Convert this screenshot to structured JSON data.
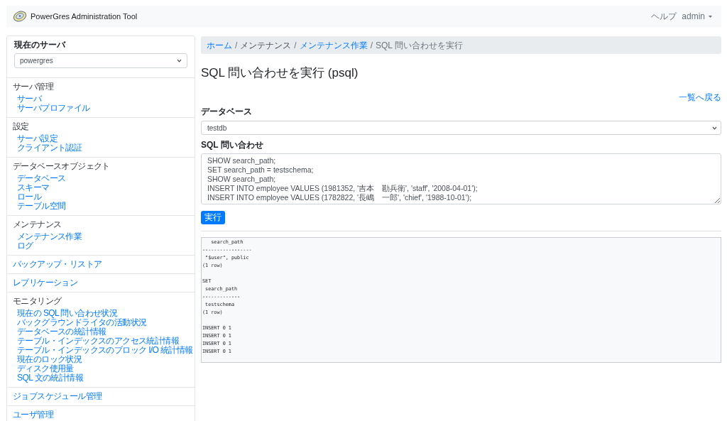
{
  "header": {
    "title": "PowerGres Administration Tool",
    "nav": [
      {
        "label": "ヘルプ",
        "kind": "link"
      },
      {
        "label": "admin",
        "kind": "dropdown"
      }
    ]
  },
  "sidebar": {
    "current_server": {
      "label": "現在のサーバ",
      "value": "powergres"
    },
    "sections": [
      {
        "kind": "group",
        "title": "サーバ管理",
        "links": [
          "サーバ",
          "サーバプロファイル"
        ]
      },
      {
        "kind": "group",
        "title": "設定",
        "links": [
          "サーバ設定",
          "クライアント認証"
        ]
      },
      {
        "kind": "group",
        "title": "データベースオブジェクト",
        "links": [
          "データベース",
          "スキーマ",
          "ロール",
          "テーブル空間"
        ]
      },
      {
        "kind": "group",
        "title": "メンテナンス",
        "links": [
          "メンテナンス作業",
          "ログ"
        ]
      },
      {
        "kind": "link",
        "title": "バックアップ・リストア"
      },
      {
        "kind": "link",
        "title": "レプリケーション"
      },
      {
        "kind": "group",
        "title": "モニタリング",
        "links": [
          "現在の SQL 問い合わせ状況",
          "バックグラウンドライタの活動状況",
          "データベースの統計情報",
          "テーブル・インデックスのアクセス統計情報",
          "テーブル・インデックスのブロック I/O 統計情報",
          "現在のロック状況",
          "ディスク使用量",
          "SQL 文の統計情報"
        ]
      },
      {
        "kind": "link",
        "title": "ジョブスケジュール管理"
      },
      {
        "kind": "link",
        "title": "ユーザ管理"
      }
    ]
  },
  "breadcrumb": {
    "items": [
      {
        "label": "ホーム",
        "kind": "link"
      },
      {
        "label": "メンテナンス",
        "kind": "text"
      },
      {
        "label": "メンテナンス作業",
        "kind": "link"
      },
      {
        "label": "SQL 問い合わせを実行",
        "kind": "active"
      }
    ],
    "separators": [
      "/",
      "/",
      "/"
    ]
  },
  "page": {
    "title": "SQL 問い合わせを実行 (psql)",
    "back_link": "一覧へ戻る",
    "database": {
      "label": "データベース",
      "value": "testdb"
    },
    "sql_query": {
      "label": "SQL 問い合わせ",
      "value": "SHOW search_path;\nSET search_path = testschema;\nSHOW search_path;\nINSERT INTO employee VALUES (1981352, '吉本　勘兵衛', 'staff', '2008-04-01');\nINSERT INTO employee VALUES (1782822, '長嶋　一郎', 'chief', '1988-10-01');"
    },
    "run_button": "実行",
    "output": "   search_path\n-----------------\n \"$user\", public\n(1 row)\n\nSET\n search_path\n-------------\n testschema\n(1 row)\n\nINSERT 0 1\nINSERT 0 1\nINSERT 0 1\nINSERT 0 1"
  }
}
